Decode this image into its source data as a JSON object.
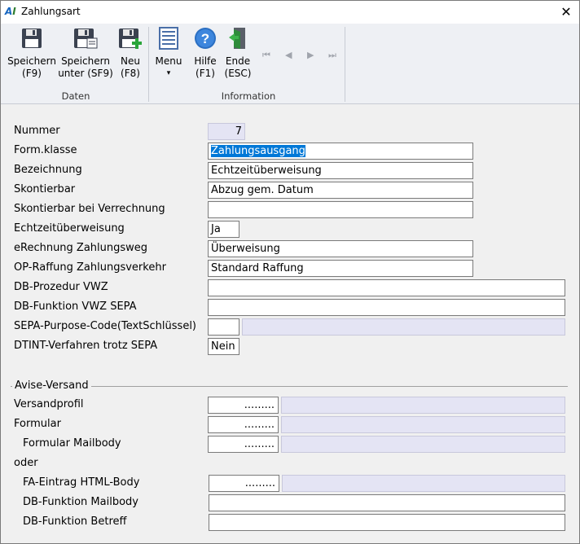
{
  "window": {
    "logo": "AI",
    "title": "Zahlungsart",
    "close": "✕"
  },
  "toolbar": {
    "save": [
      "Speichern",
      "(F9)"
    ],
    "save_as": [
      "Speichern",
      "unter (SF9)"
    ],
    "new": [
      "Neu",
      "(F8)"
    ],
    "menu": [
      "Menu",
      "▾"
    ],
    "help": [
      "Hilfe",
      "(F1)"
    ],
    "exit": [
      "Ende",
      "(ESC)"
    ],
    "group_data": "Daten",
    "group_info": "Information",
    "nav": [
      "⏮",
      "◀",
      "▶",
      "⏭"
    ]
  },
  "form": {
    "nummer": {
      "label": "Nummer",
      "value": "7"
    },
    "formklasse": {
      "label": "Form.klasse",
      "value": "Zahlungsausgang"
    },
    "bezeichnung": {
      "label": "Bezeichnung",
      "value": "Echtzeitüberweisung"
    },
    "skontierbar": {
      "label": "Skontierbar",
      "value": "Abzug gem. Datum"
    },
    "skontierbar_verr": {
      "label": "Skontierbar bei Verrechnung",
      "value": ""
    },
    "echtzeit": {
      "label": "Echtzeitüberweisung",
      "value": "Ja"
    },
    "erechnung": {
      "label": "eRechnung Zahlungsweg",
      "value": "Überweisung"
    },
    "op_raffung": {
      "label": "OP-Raffung Zahlungsverkehr",
      "value": "Standard Raffung"
    },
    "db_prozedur": {
      "label": "DB-Prozedur VWZ",
      "value": ""
    },
    "db_funktion_sepa": {
      "label": "DB-Funktion VWZ SEPA",
      "value": ""
    },
    "sepa_purpose": {
      "label": "SEPA-Purpose-Code(TextSchlüssel)",
      "value": "",
      "desc": ""
    },
    "dtint": {
      "label": "DTINT-Verfahren trotz SEPA",
      "value": "Nein"
    }
  },
  "avise": {
    "group_label": "Avise-Versand",
    "versandprofil": {
      "label": "Versandprofil",
      "value": "........."
    },
    "formular": {
      "label": "Formular",
      "value": "........."
    },
    "formular_mailbody": {
      "label": "Formular Mailbody",
      "value": "........."
    },
    "oder": "oder",
    "fa_eintrag": {
      "label": "FA-Eintrag HTML-Body",
      "value": "........."
    },
    "db_funktion_mailbody": {
      "label": "DB-Funktion Mailbody",
      "value": ""
    },
    "db_funktion_betreff": {
      "label": "DB-Funktion Betreff",
      "value": ""
    }
  }
}
